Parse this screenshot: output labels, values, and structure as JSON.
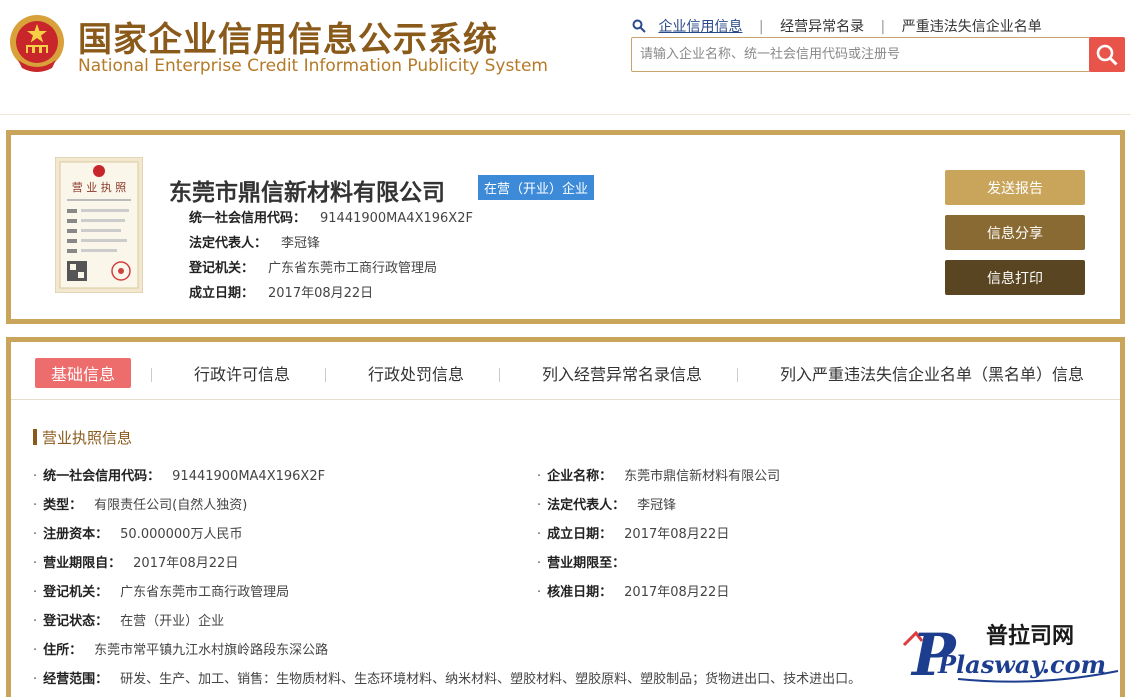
{
  "header": {
    "title_cn": "国家企业信用信息公示系统",
    "title_en": "National Enterprise Credit Information Publicity System",
    "links": [
      "企业信用信息",
      "经营异常名录",
      "严重违法失信企业名单"
    ],
    "search_placeholder": "请输入企业名称、统一社会信用代码或注册号",
    "icons": {
      "emblem": "national-emblem-icon",
      "search": "search-icon"
    },
    "colors": {
      "title": "#8a5a1b",
      "search_button": "#e9544a"
    }
  },
  "company": {
    "name": "东莞市鼎信新材料有限公司",
    "status": "在营（开业）企业",
    "license_icon": "business-license-icon",
    "license_title": "营 业 执 照",
    "info": [
      {
        "label": "统一社会信用代码：",
        "value": "91441900MA4X196X2F"
      },
      {
        "label": "法定代表人：",
        "value": "李冠锋"
      },
      {
        "label": "登记机关：",
        "value": "广东省东莞市工商行政管理局"
      },
      {
        "label": "成立日期：",
        "value": "2017年08月22日"
      }
    ],
    "actions": [
      "发送报告",
      "信息分享",
      "信息打印"
    ],
    "colors": {
      "border": "#c9a55b",
      "status_badge": "#3d8bd8",
      "action_1": "#c9a55b",
      "action_2": "#8a6a33",
      "action_3": "#5a4522"
    }
  },
  "tabs": [
    "基础信息",
    "行政许可信息",
    "行政处罚信息",
    "列入经营异常名录信息",
    "列入严重违法失信企业名单（黑名单）信息"
  ],
  "section": {
    "title": "营业执照信息",
    "fields": {
      "credit_code": {
        "label": "统一社会信用代码：",
        "value": "91441900MA4X196X2F"
      },
      "company_name": {
        "label": "企业名称：",
        "value": "东莞市鼎信新材料有限公司"
      },
      "type": {
        "label": "类型：",
        "value": "有限责任公司(自然人独资)"
      },
      "legal_rep": {
        "label": "法定代表人：",
        "value": "李冠锋"
      },
      "capital": {
        "label": "注册资本：",
        "value": "50.000000万人民币"
      },
      "established": {
        "label": "成立日期：",
        "value": "2017年08月22日"
      },
      "term_from": {
        "label": "营业期限自：",
        "value": "2017年08月22日"
      },
      "term_to": {
        "label": "营业期限至：",
        "value": ""
      },
      "authority": {
        "label": "登记机关：",
        "value": "广东省东莞市工商行政管理局"
      },
      "approved": {
        "label": "核准日期：",
        "value": "2017年08月22日"
      },
      "reg_status": {
        "label": "登记状态：",
        "value": "在营（开业）企业"
      },
      "address": {
        "label": "住所：",
        "value": "东莞市常平镇九江水村旗岭路段东深公路"
      },
      "scope": {
        "label": "经营范围：",
        "value": "研发、生产、加工、销售：生物质材料、生态环境材料、纳米材料、塑胶材料、塑胶原料、塑胶制品；货物进出口、技术进出口。"
      }
    }
  },
  "watermark": {
    "cn": "普拉司网",
    "en": "Plasway.com",
    "icon": "plasway-logo-icon"
  }
}
